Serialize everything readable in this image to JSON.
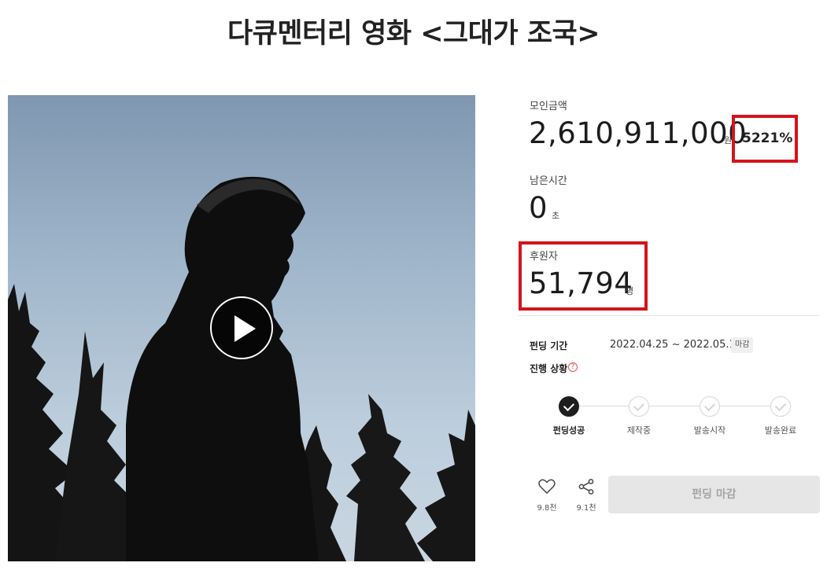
{
  "page_title": "다큐멘터리 영화 <그대가 조국>",
  "media": {
    "play_icon": "play-icon"
  },
  "stats": {
    "amount_label": "모인금액",
    "amount_value": "2,610,911,000",
    "amount_unit": "원",
    "percent": "5221%",
    "time_label": "남은시간",
    "time_value": "0",
    "time_unit": "초",
    "backers_label": "후원자",
    "backers_value": "51,794",
    "backers_unit": "명"
  },
  "highlight_color": "#d5141c",
  "info": {
    "period_label": "펀딩 기간",
    "period_value": "2022.04.25 ~ 2022.05.15",
    "period_badge": "마감",
    "progress_label": "진행 상황",
    "help_icon": "?"
  },
  "steps": [
    {
      "label": "펀딩성공",
      "done": true
    },
    {
      "label": "제작중",
      "done": false
    },
    {
      "label": "발송시작",
      "done": false
    },
    {
      "label": "발송완료",
      "done": false
    }
  ],
  "actions": {
    "like_icon": "heart-icon",
    "like_count": "9.8천",
    "share_icon": "share-icon",
    "share_count": "9.1천",
    "fund_button": "펀딩 마감"
  }
}
